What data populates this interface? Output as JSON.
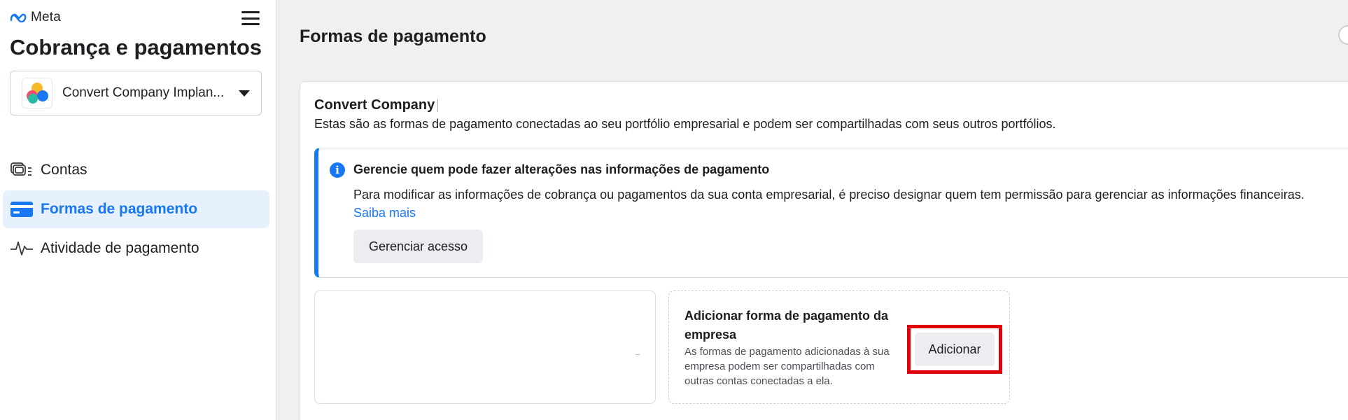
{
  "brand": {
    "logo_text": "Meta"
  },
  "sidebar": {
    "title": "Cobrança e pagamentos",
    "account_selector": {
      "value": "Convert Company Implan..."
    },
    "items": [
      {
        "label": "Contas",
        "icon": "accounts-icon",
        "active": false
      },
      {
        "label": "Formas de pagamento",
        "icon": "credit-card-icon",
        "active": true
      },
      {
        "label": "Atividade de pagamento",
        "icon": "activity-pulse-icon",
        "active": false
      }
    ]
  },
  "main": {
    "page_title": "Formas de pagamento",
    "company": {
      "name": "Convert Company",
      "description": "Estas são as formas de pagamento conectadas ao seu portfólio empresarial e podem ser compartilhadas com seus outros portfólios."
    },
    "info_box": {
      "title": "Gerencie quem pode fazer alterações nas informações de pagamento",
      "text": "Para modificar as informações de cobrança ou pagamentos da sua conta empresarial, é preciso designar quem tem permissão para gerenciar as informações financeiras.",
      "link": "Saiba mais",
      "button": "Gerenciar acesso"
    },
    "add_card": {
      "title": "Adicionar forma de pagamento da empresa",
      "description": "As formas de pagamento adicionadas à sua empresa podem ser compartilhadas com outras contas conectadas a ela.",
      "button": "Adicionar"
    }
  },
  "colors": {
    "accent": "#1877f2",
    "active_nav_bg": "#e7f0fd",
    "highlight": "#e0000a",
    "page_bg": "#f0f0f0"
  }
}
